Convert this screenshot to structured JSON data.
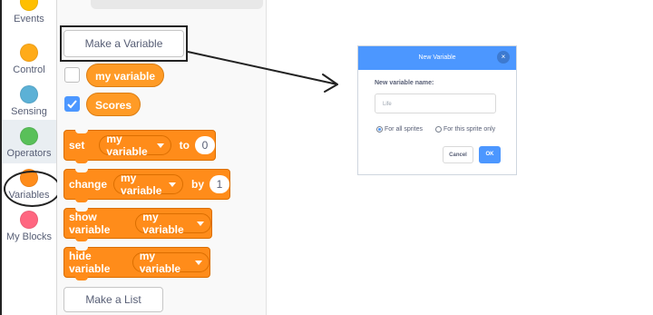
{
  "categories": [
    {
      "label": "Events",
      "color": "#ffbf00",
      "icon": "events-dot-icon"
    },
    {
      "label": "Control",
      "color": "#ffab19",
      "icon": "control-dot-icon"
    },
    {
      "label": "Sensing",
      "color": "#5cb1d6",
      "icon": "sensing-dot-icon"
    },
    {
      "label": "Operators",
      "color": "#59c059",
      "icon": "operators-dot-icon"
    },
    {
      "label": "Variables",
      "color": "#ff8c1a",
      "icon": "variables-dot-icon"
    },
    {
      "label": "My Blocks",
      "color": "#ff6680",
      "icon": "my-blocks-dot-icon"
    }
  ],
  "palette": {
    "make_variable_label": "Make a Variable",
    "variables": [
      {
        "name": "my variable",
        "checked": false
      },
      {
        "name": "Scores",
        "checked": true
      }
    ],
    "blocks": {
      "set": {
        "verb": "set",
        "var": "my variable",
        "prep": "to",
        "value": "0"
      },
      "change": {
        "verb": "change",
        "var": "my variable",
        "prep": "by",
        "value": "1"
      },
      "show": {
        "verb": "show variable",
        "var": "my variable"
      },
      "hide": {
        "verb": "hide variable",
        "var": "my variable"
      }
    },
    "make_list_label": "Make a List"
  },
  "dialog": {
    "title": "New Variable",
    "close_icon": "×",
    "name_label": "New variable name:",
    "name_value": "Life",
    "radio_all": "For all sprites",
    "radio_this": "For this sprite only",
    "selected_scope": "For all sprites",
    "cancel_label": "Cancel",
    "ok_label": "OK"
  },
  "colors": {
    "variables_orange": "#ff8c1a",
    "accent_blue": "#4c97ff"
  }
}
